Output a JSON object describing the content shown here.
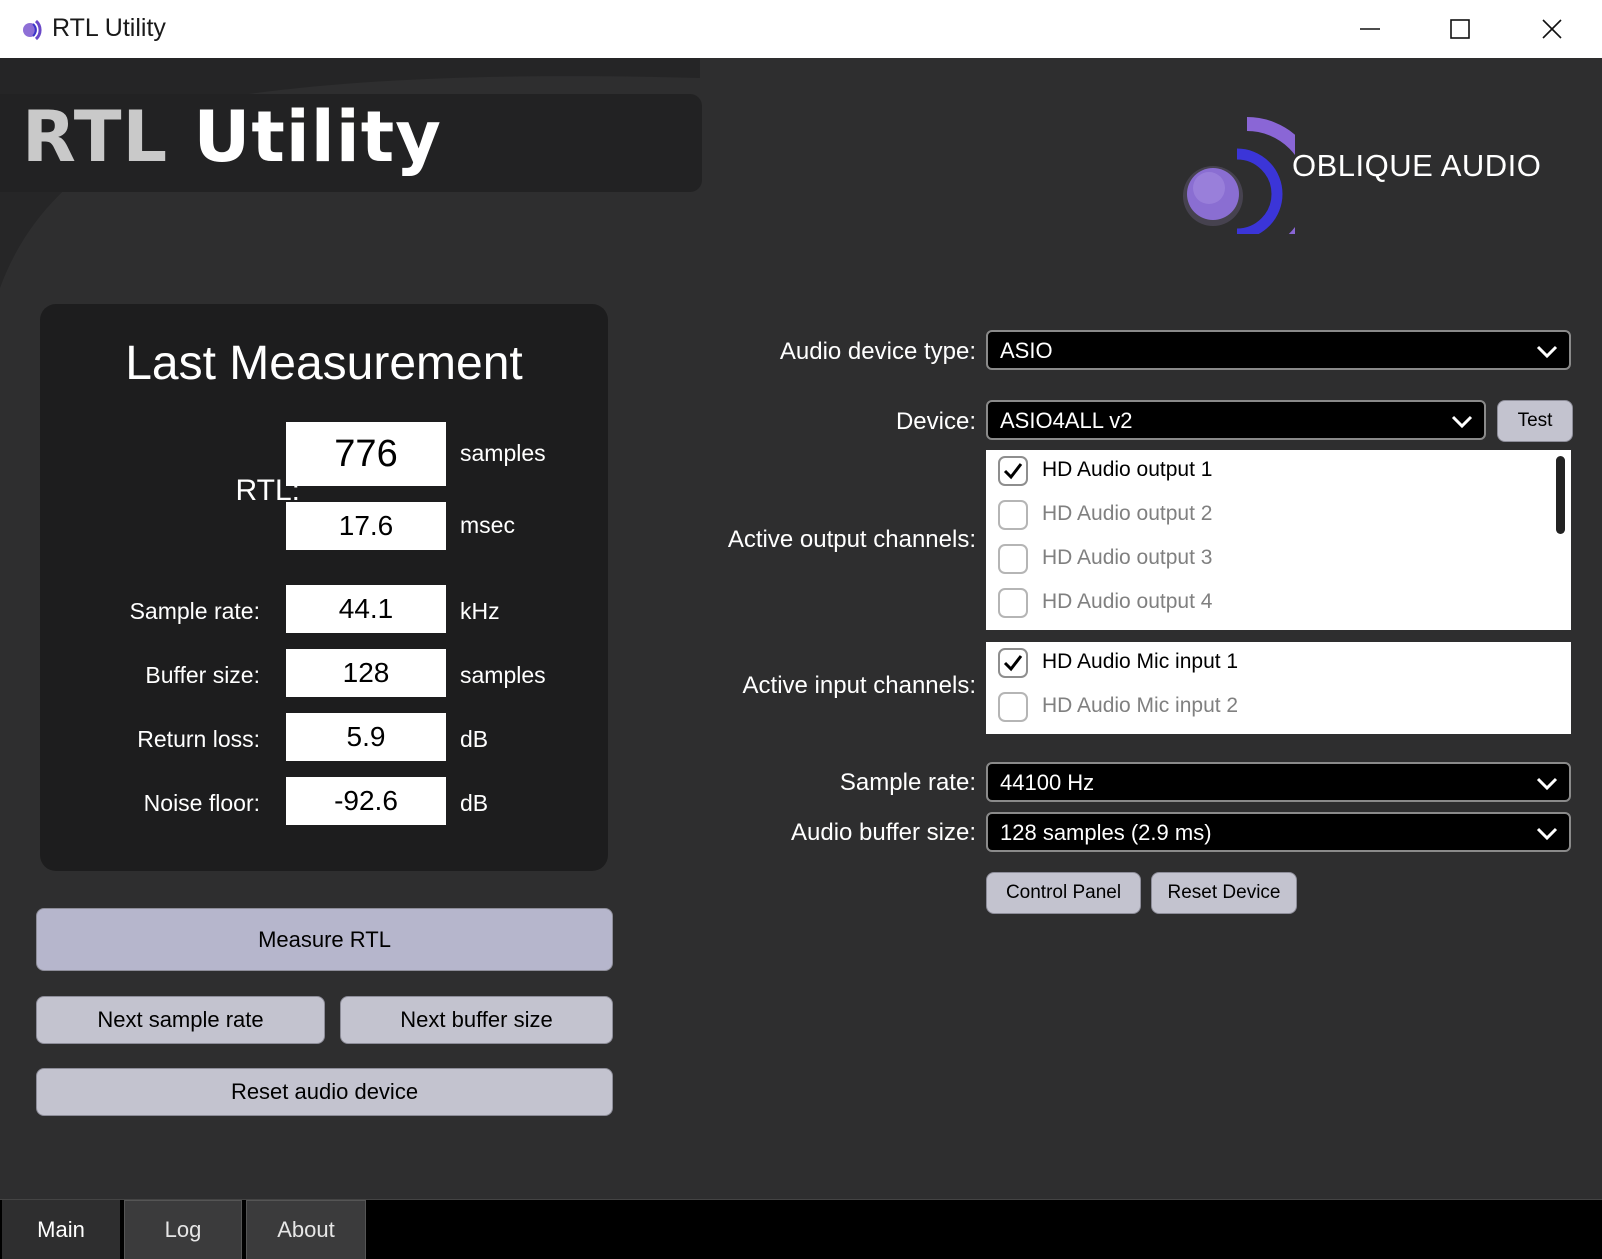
{
  "window": {
    "title": "RTL Utility",
    "icons": {
      "minimize": "minimize-icon",
      "maximize": "maximize-icon",
      "close": "close-icon"
    }
  },
  "header": {
    "title_part1": "RTL",
    "title_part2": " Utility",
    "brand": "OBLIQUE AUDIO",
    "accent_color": "#7b5cc9"
  },
  "measurement": {
    "title": "Last Measurement",
    "rtl_label": "RTL:",
    "rtl_samples": "776",
    "rtl_samples_unit": "samples",
    "rtl_msec": "17.6",
    "rtl_msec_unit": "msec",
    "sample_rate_label": "Sample rate:",
    "sample_rate": "44.1",
    "sample_rate_unit": "kHz",
    "buffer_label": "Buffer size:",
    "buffer": "128",
    "buffer_unit": "samples",
    "return_loss_label": "Return loss:",
    "return_loss": "5.9",
    "return_loss_unit": "dB",
    "noise_label": "Noise floor:",
    "noise": "-92.6",
    "noise_unit": "dB"
  },
  "actions": {
    "measure": "Measure RTL",
    "next_sample_rate": "Next sample rate",
    "next_buffer_size": "Next buffer size",
    "reset_audio": "Reset audio device"
  },
  "settings": {
    "device_type_label": "Audio device type:",
    "device_type_value": "ASIO",
    "device_label": "Device:",
    "device_value": "ASIO4ALL v2",
    "test_label": "Test",
    "output_label": "Active output channels:",
    "outputs": [
      {
        "label": "HD Audio output 1",
        "checked": true
      },
      {
        "label": "HD Audio output 2",
        "checked": false
      },
      {
        "label": "HD Audio output 3",
        "checked": false
      },
      {
        "label": "HD Audio output 4",
        "checked": false
      }
    ],
    "input_label": "Active input channels:",
    "inputs": [
      {
        "label": "HD Audio Mic input 1",
        "checked": true
      },
      {
        "label": "HD Audio Mic input 2",
        "checked": false
      }
    ],
    "sample_rate_label": "Sample rate:",
    "sample_rate_value": "44100 Hz",
    "buffer_label": "Audio buffer size:",
    "buffer_value": "128 samples (2.9 ms)",
    "control_panel_label": "Control Panel",
    "reset_device_label": "Reset Device"
  },
  "tabs": [
    {
      "label": "Main",
      "active": true
    },
    {
      "label": "Log",
      "active": false
    },
    {
      "label": "About",
      "active": false
    }
  ]
}
